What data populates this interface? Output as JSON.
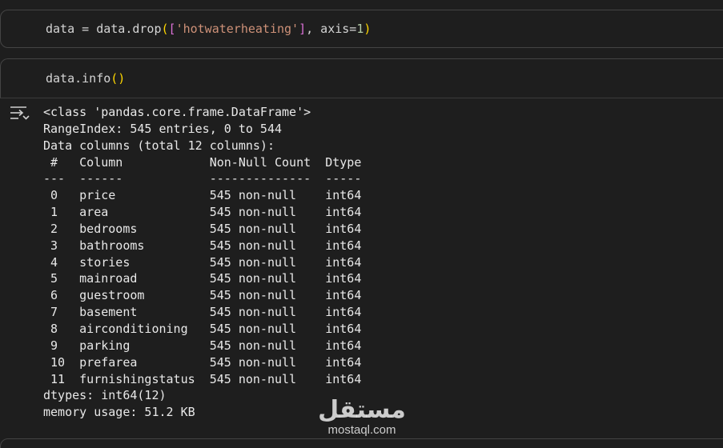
{
  "cells": [
    {
      "tokens": [
        {
          "t": "data = data.drop",
          "c": ""
        },
        {
          "t": "(",
          "c": "tok-br1"
        },
        {
          "t": "[",
          "c": "tok-br2"
        },
        {
          "t": "'hotwaterheating'",
          "c": "tok-str"
        },
        {
          "t": "]",
          "c": "tok-br2"
        },
        {
          "t": ", axis=",
          "c": ""
        },
        {
          "t": "1",
          "c": "tok-num"
        },
        {
          "t": ")",
          "c": "tok-br1"
        }
      ]
    },
    {
      "tokens": [
        {
          "t": "data.info",
          "c": ""
        },
        {
          "t": "()",
          "c": "tok-br1"
        }
      ]
    }
  ],
  "output": {
    "icon": "output-toggle-icon",
    "lines": [
      "<class 'pandas.core.frame.DataFrame'>",
      "RangeIndex: 545 entries, 0 to 544",
      "Data columns (total 12 columns):",
      " #   Column            Non-Null Count  Dtype",
      "---  ------            --------------  -----",
      " 0   price             545 non-null    int64",
      " 1   area              545 non-null    int64",
      " 2   bedrooms          545 non-null    int64",
      " 3   bathrooms         545 non-null    int64",
      " 4   stories           545 non-null    int64",
      " 5   mainroad          545 non-null    int64",
      " 6   guestroom         545 non-null    int64",
      " 7   basement          545 non-null    int64",
      " 8   airconditioning   545 non-null    int64",
      " 9   parking           545 non-null    int64",
      " 10  prefarea          545 non-null    int64",
      " 11  furnishingstatus  545 non-null    int64",
      "dtypes: int64(12)",
      "memory usage: 51.2 KB"
    ]
  },
  "watermark": {
    "mark": "مستقل",
    "site": "mostaql.com"
  }
}
